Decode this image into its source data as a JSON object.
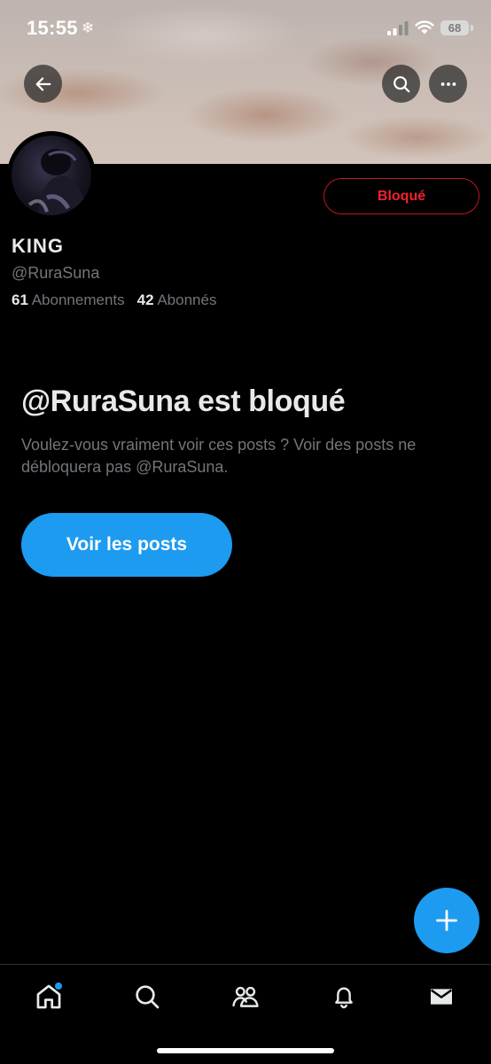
{
  "status_bar": {
    "time": "15:55",
    "snow_glyph": "❄",
    "battery": "68",
    "icons": [
      "signal-icon",
      "wifi-icon",
      "battery-icon",
      "snowflake-icon"
    ]
  },
  "header": {
    "icons": [
      "back-arrow-icon",
      "search-icon",
      "more-icon"
    ]
  },
  "profile": {
    "display_name": "KING",
    "handle": "@RuraSuna",
    "following_count": "61",
    "following_label": "Abonnements",
    "followers_count": "42",
    "followers_label": "Abonnés",
    "blocked_button_label": "Bloqué"
  },
  "blocked_notice": {
    "title": "@RuraSuna est bloqué",
    "description": "Voulez-vous vraiment voir ces posts ? Voir des posts ne débloquera pas @RuraSuna.",
    "view_posts_label": "Voir les posts"
  },
  "fab": {
    "icon": "plus-icon"
  },
  "tab_bar": {
    "items": [
      "home-icon",
      "search-icon",
      "communities-icon",
      "notifications-icon",
      "messages-icon"
    ],
    "home_has_badge": true
  },
  "colors": {
    "accent": "#1d9bf0",
    "blocked_red": "#f4212e",
    "background": "#000000",
    "secondary_text": "#71767b"
  }
}
